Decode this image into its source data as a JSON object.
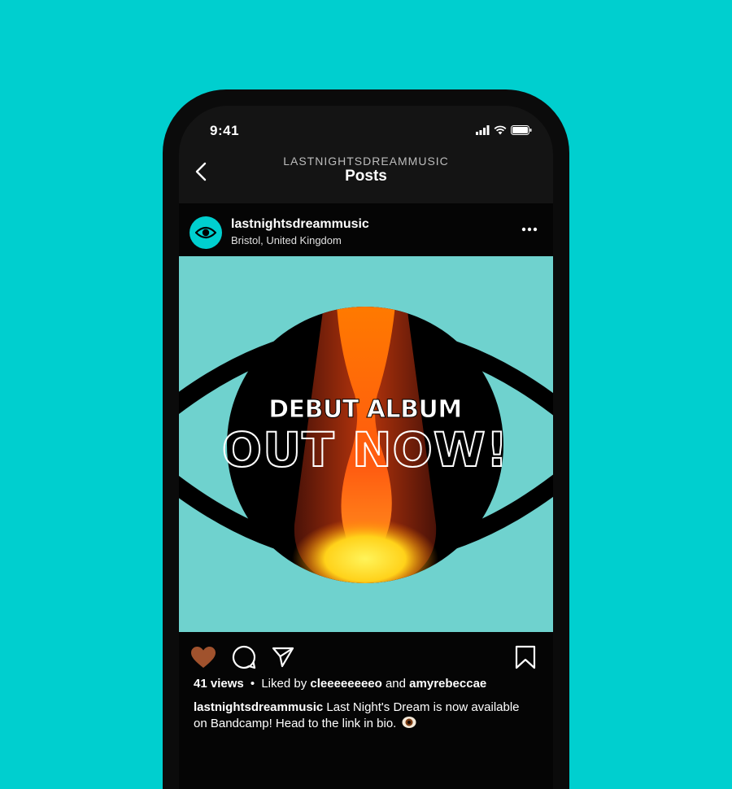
{
  "status_bar": {
    "time": "9:41"
  },
  "nav": {
    "account": "LASTNIGHTSDREAMMUSIC",
    "title": "Posts"
  },
  "post": {
    "username": "lastnightsdreammusic",
    "location": "Bristol, United Kingdom",
    "artwork": {
      "line1": "DEBUT ALBUM",
      "line2": "OUT NOW!"
    },
    "liked": true,
    "views": "41 views",
    "separator": "•",
    "liked_by_prefix": "Liked by",
    "liked_by_user1": "cleeeeeeeeo",
    "liked_by_and": "and",
    "liked_by_user2": "amyrebeccae",
    "caption_user": "lastnightsdreammusic",
    "caption_text": "Last Night's Dream is now available on Bandcamp! Head to the link in bio.",
    "caption_emoji_icon": "eye-icon"
  },
  "colors": {
    "background": "#00CFCF",
    "artwork_bg": "#6FD2CE",
    "heart": "#A0522D"
  }
}
